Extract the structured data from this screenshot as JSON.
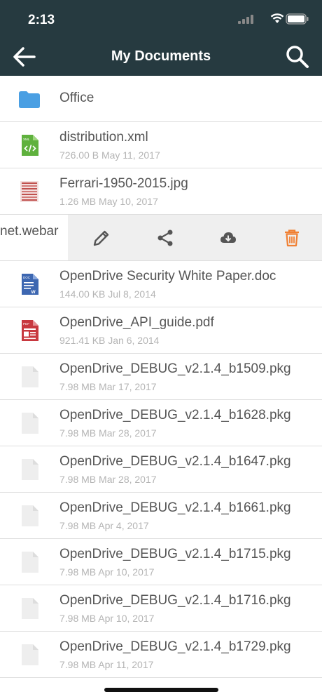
{
  "status_bar": {
    "time": "2:13"
  },
  "nav": {
    "title": "My Documents"
  },
  "files": [
    {
      "name": "Office",
      "meta": "",
      "type": "folder"
    },
    {
      "name": "distribution.xml",
      "meta": "726.00 B May 11, 2017",
      "type": "xml"
    },
    {
      "name": "Ferrari-1950-2015.jpg",
      "meta": "1.26 MB May 10, 2017",
      "type": "jpg"
    }
  ],
  "swipe_row": {
    "partial_name": "net.webar"
  },
  "files_after": [
    {
      "name": "OpenDrive Security White Paper.doc",
      "meta": "144.00 KB Jul 8, 2014",
      "type": "doc"
    },
    {
      "name": "OpenDrive_API_guide.pdf",
      "meta": "921.41 KB Jan 6, 2014",
      "type": "pdf"
    },
    {
      "name": "OpenDrive_DEBUG_v2.1.4_b1509.pkg",
      "meta": "7.98 MB Mar 17, 2017",
      "type": "pkg"
    },
    {
      "name": "OpenDrive_DEBUG_v2.1.4_b1628.pkg",
      "meta": "7.98 MB Mar 28, 2017",
      "type": "pkg"
    },
    {
      "name": "OpenDrive_DEBUG_v2.1.4_b1647.pkg",
      "meta": "7.98 MB Mar 28, 2017",
      "type": "pkg"
    },
    {
      "name": "OpenDrive_DEBUG_v2.1.4_b1661.pkg",
      "meta": "7.98 MB Apr 4, 2017",
      "type": "pkg"
    },
    {
      "name": "OpenDrive_DEBUG_v2.1.4_b1715.pkg",
      "meta": "7.98 MB Apr 10, 2017",
      "type": "pkg"
    },
    {
      "name": "OpenDrive_DEBUG_v2.1.4_b1716.pkg",
      "meta": "7.98 MB Apr 10, 2017",
      "type": "pkg"
    },
    {
      "name": "OpenDrive_DEBUG_v2.1.4_b1729.pkg",
      "meta": "7.98 MB Apr 11, 2017",
      "type": "pkg"
    }
  ],
  "colors": {
    "header_bg": "#263a40",
    "folder": "#4a9fe3",
    "delete": "#f08033"
  }
}
